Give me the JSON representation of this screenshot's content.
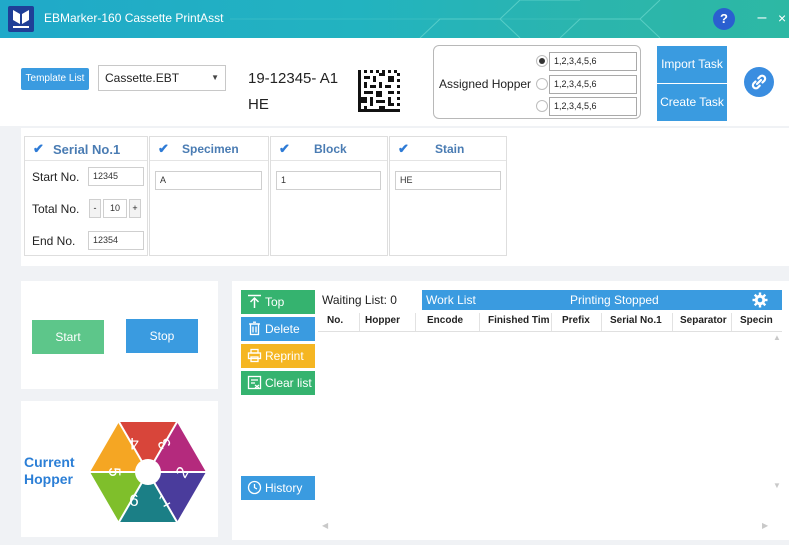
{
  "app": {
    "title": "EBMarker-160 Cassette PrintAsst"
  },
  "titlebar": {
    "help": "?",
    "minimize": "–",
    "close": "×"
  },
  "template": {
    "button": "Template List",
    "selected": "Cassette.EBT"
  },
  "preview": {
    "line1": "19-12345- A1",
    "line2": "HE"
  },
  "hopper": {
    "label": "Assigned Hopper",
    "options": [
      "1,2,3,4,5,6",
      "1,2,3,4,5,6",
      "1,2,3,4,5,6"
    ],
    "selected_index": 0
  },
  "actions": {
    "import": "Import Task",
    "create": "Create Task"
  },
  "fields": {
    "serial": {
      "title": "Serial No.1",
      "start_label": "Start  No.",
      "start_value": "12345",
      "total_label": "Total No.",
      "total_value": "10",
      "minus": "-",
      "plus": "+",
      "end_label": "End   No.",
      "end_value": "12354"
    },
    "specimen": {
      "title": "Specimen",
      "value": "A"
    },
    "block": {
      "title": "Block",
      "value": "1"
    },
    "stain": {
      "title": "Stain",
      "value": "HE"
    }
  },
  "controls": {
    "start": "Start",
    "stop": "Stop"
  },
  "current_hopper": {
    "line1": "Current",
    "line2": "Hopper",
    "numbers": [
      "4",
      "3",
      "2",
      "1",
      "6",
      "5"
    ]
  },
  "side_buttons": {
    "top": "Top",
    "delete": "Delete",
    "reprint": "Reprint",
    "clear": "Clear list",
    "history": "History"
  },
  "side_colors": {
    "top": "#35b36f",
    "delete": "#3a9be0",
    "reprint": "#f5b622",
    "clear": "#35b36f",
    "history": "#3a9be0"
  },
  "hexagon_colors": [
    "#d8453a",
    "#b42a7d",
    "#4a3c9c",
    "#1b7f86",
    "#7fbf2b",
    "#f5a623"
  ],
  "worklist": {
    "waiting": "Waiting List: 0",
    "title": "Work List",
    "status": "Printing Stopped",
    "columns": [
      "No.",
      "Hopper",
      "Encode",
      "Finished Tim",
      "Prefix",
      "Serial No.1",
      "Separator",
      "Specin"
    ]
  }
}
